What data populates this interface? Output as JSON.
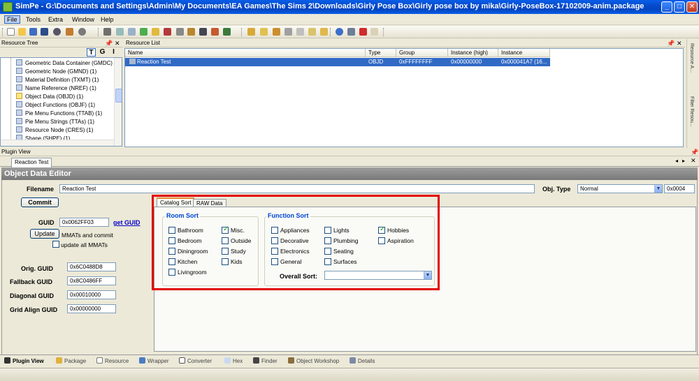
{
  "window": {
    "title": "SimPe - G:\\Documents and Settings\\Admin\\My Documents\\EA Games\\The Sims 2\\Downloads\\Girly Pose Box\\Girly pose box by mika\\Girly-PoseBox-17102009-anim.package"
  },
  "menu": [
    "File",
    "Tools",
    "Extra",
    "Window",
    "Help"
  ],
  "resource_tree": {
    "title": "Resource Tree",
    "filters": [
      "T",
      "G",
      "I"
    ],
    "items": [
      "Geometric Data Container (GMDC) (1)",
      "Geometric Node (GMND) (1)",
      "Material Definition (TXMT) (1)",
      "Name Reference (NREF) (1)",
      "Object Data (OBJD) (1)",
      "Object Functions (OBJF) (1)",
      "Pie Menu Functions (TTAB) (1)",
      "Pie Menu Strings (TTAs) (1)",
      "Resource Node (CRES) (1)",
      "Shape (SHPE) (1)"
    ]
  },
  "resource_list": {
    "title": "Resource List",
    "columns": [
      "Name",
      "Type",
      "Group",
      "Instance (high)",
      "Instance"
    ],
    "rows": [
      {
        "name": "Reaction Test",
        "type": "OBJD",
        "group": "0xFFFFFFFF",
        "instance_high": "0x00000000",
        "instance": "0x000041A7 (16..."
      }
    ]
  },
  "side_panels": [
    "Resource A...",
    "Filter Resou..."
  ],
  "plugin_view": {
    "title": "Plugin View",
    "tab": "Reaction Test",
    "editor_title": "Object Data Editor",
    "filename_label": "Filename",
    "filename": "Reaction Test",
    "commit_label": "Commit",
    "objtype_label": "Obj. Type",
    "objtype_value": "Normal",
    "objtype_code": "0x0004",
    "guid_label": "GUID",
    "guid": "0x0062FF03",
    "get_guid": "get GUID",
    "update_label": "Update",
    "update_text": "MMATs and commit",
    "update_all_label": "update all MMATs",
    "orig_guid_label": "Orig. GUID",
    "orig_guid": "0x6C0488D8",
    "fallback_guid_label": "Fallback GUID",
    "fallback_guid": "0x8C0486FF",
    "diagonal_guid_label": "Diagonal GUID",
    "diagonal_guid": "0x00010000",
    "grid_guid_label": "Grid Align GUID",
    "grid_guid": "0x00000000",
    "tabs": [
      "Catalog Sort",
      "RAW Data"
    ],
    "room_sort": {
      "title": "Room Sort",
      "items": [
        {
          "label": "Bathroom",
          "checked": false
        },
        {
          "label": "Bedroom",
          "checked": false
        },
        {
          "label": "Diningroom",
          "checked": false
        },
        {
          "label": "Kitchen",
          "checked": false
        },
        {
          "label": "Livingroom",
          "checked": false
        },
        {
          "label": "Misc.",
          "checked": true
        },
        {
          "label": "Outside",
          "checked": false
        },
        {
          "label": "Study",
          "checked": false
        },
        {
          "label": "Kids",
          "checked": false
        }
      ]
    },
    "function_sort": {
      "title": "Function Sort",
      "items": [
        {
          "label": "Appliances",
          "checked": false
        },
        {
          "label": "Decorative",
          "checked": false
        },
        {
          "label": "Electronics",
          "checked": false
        },
        {
          "label": "General",
          "checked": false
        },
        {
          "label": "Lights",
          "checked": false
        },
        {
          "label": "Plumbing",
          "checked": false
        },
        {
          "label": "Seating",
          "checked": false
        },
        {
          "label": "Surfaces",
          "checked": false
        },
        {
          "label": "Hobbies",
          "checked": true
        },
        {
          "label": "Aspiration",
          "checked": false
        }
      ],
      "overall_sort_label": "Overall Sort:",
      "overall_sort_value": ""
    }
  },
  "bottom_tabs": [
    "Plugin View",
    "Package",
    "Resource",
    "Wrapper",
    "Converter",
    "Hex",
    "Finder",
    "Object Workshop",
    "Details"
  ]
}
